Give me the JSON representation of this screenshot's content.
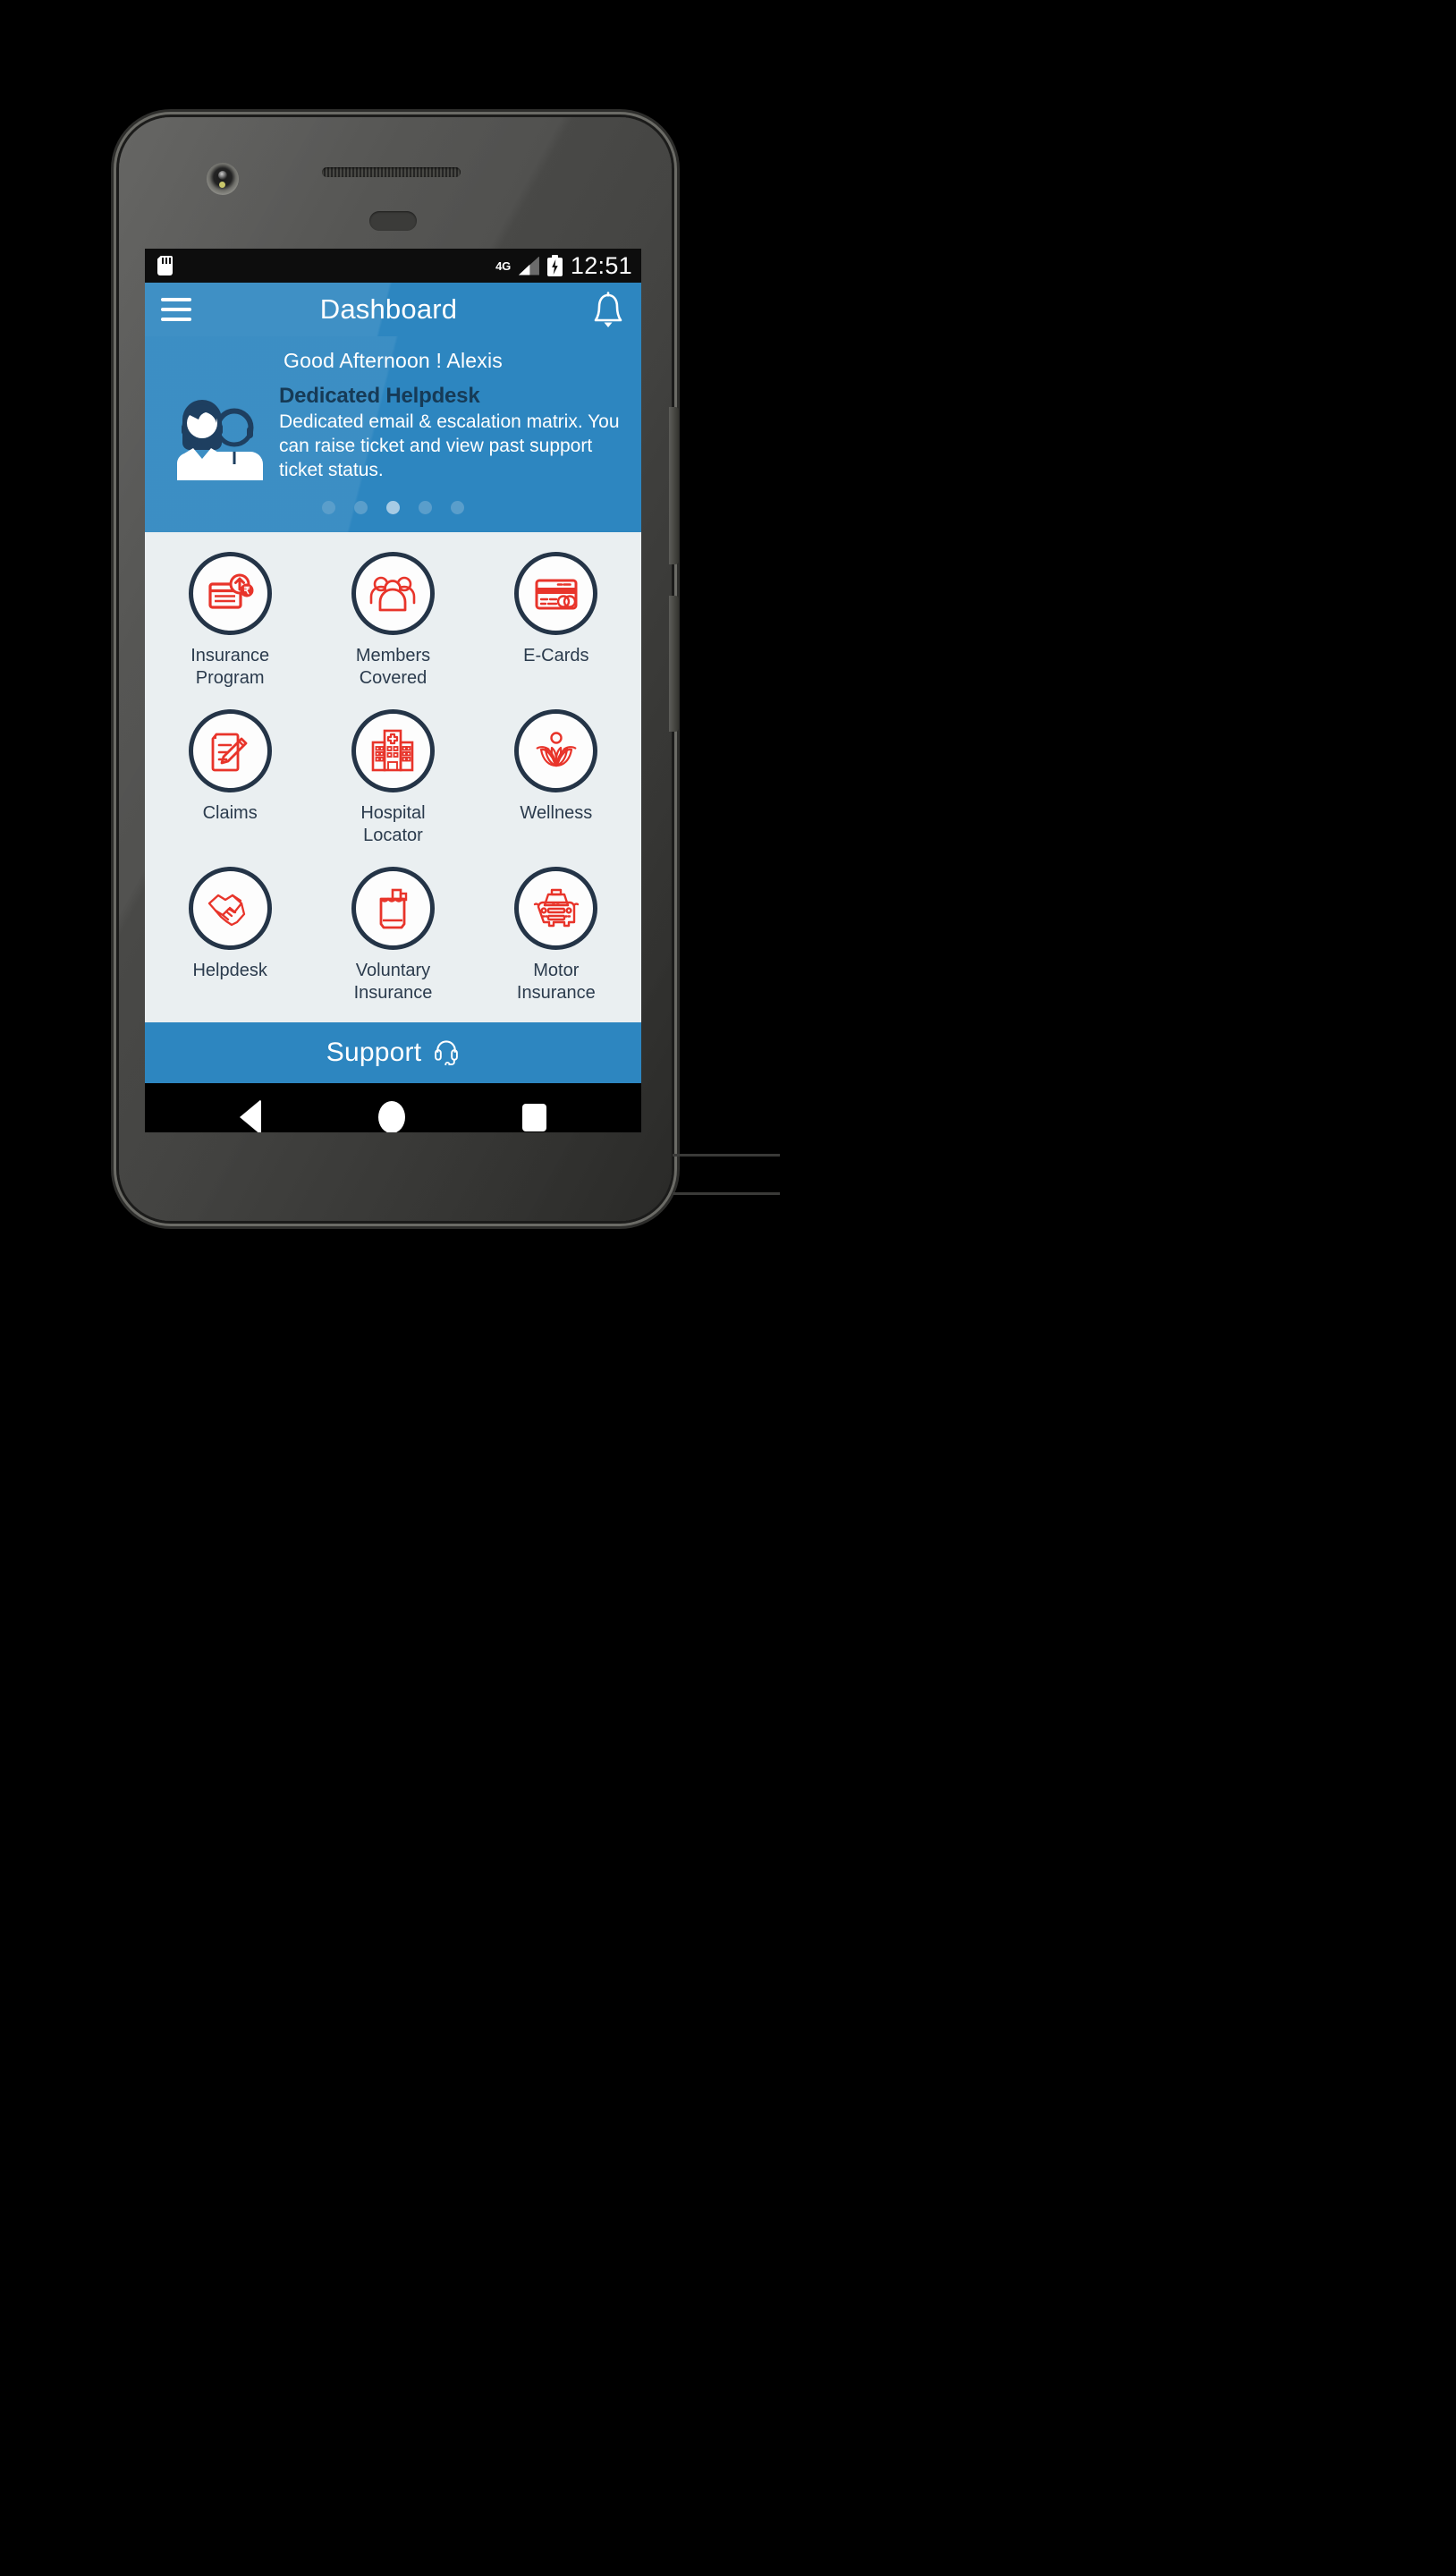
{
  "status_bar": {
    "sd_icon": "sd-card-icon",
    "network_label": "4G",
    "signal_icon": "signal-bars-icon",
    "battery_icon": "battery-charging-icon",
    "time": "12:51"
  },
  "app_bar": {
    "menu_icon": "hamburger-menu-icon",
    "title": "Dashboard",
    "notification_icon": "bell-icon"
  },
  "banner": {
    "greeting": "Good Afternoon !  Alexis",
    "illustration": "support-agents-illustration",
    "slide_title": "Dedicated Helpdesk",
    "slide_description": "Dedicated email & escalation matrix. You can raise ticket and view past support ticket status.",
    "dots_count": 5,
    "active_dot_index": 2
  },
  "grid": {
    "tiles": [
      {
        "label": "Insurance\nProgram",
        "icon": "insurance-program-icon"
      },
      {
        "label": "Members\nCovered",
        "icon": "members-covered-icon"
      },
      {
        "label": "E-Cards",
        "icon": "e-cards-icon"
      },
      {
        "label": "Claims",
        "icon": "claims-icon"
      },
      {
        "label": "Hospital\nLocator",
        "icon": "hospital-locator-icon"
      },
      {
        "label": "Wellness",
        "icon": "wellness-icon"
      },
      {
        "label": "Helpdesk",
        "icon": "helpdesk-icon"
      },
      {
        "label": "Voluntary\nInsurance",
        "icon": "voluntary-insurance-icon"
      },
      {
        "label": "Motor\nInsurance",
        "icon": "motor-insurance-icon"
      }
    ]
  },
  "support_bar": {
    "label": "Support",
    "icon": "headset-icon"
  },
  "nav_bar": {
    "back": "back-nav-icon",
    "home": "home-nav-icon",
    "recents": "recents-nav-icon"
  },
  "colors": {
    "brand_blue": "#2d86c0",
    "icon_red": "#e8342a",
    "circle_navy": "#243447",
    "grid_bg": "#eaeff1",
    "banner_title_navy": "#163a56"
  }
}
